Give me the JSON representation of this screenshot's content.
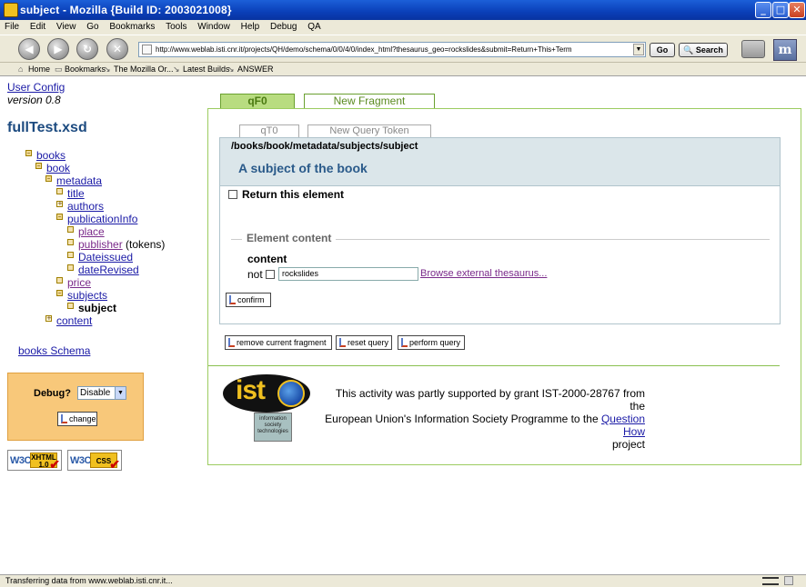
{
  "window": {
    "title": "subject - Mozilla {Build ID: 2003021008}"
  },
  "menu": [
    "File",
    "Edit",
    "View",
    "Go",
    "Bookmarks",
    "Tools",
    "Window",
    "Help",
    "Debug",
    "QA"
  ],
  "navigation": {
    "url": "http://www.weblab.isti.cnr.it/projects/QH/demo/schema/0/0/4/0/index_html?thesaurus_geo=rockslides&submit=Return+This+Term",
    "go_label": "Go",
    "search_label": "Search"
  },
  "personal_toolbar": {
    "items": [
      "Home",
      "Bookmarks",
      "The Mozilla Or...",
      "Latest Builds",
      "ANSWER"
    ]
  },
  "sidebar": {
    "user_config": "User Config",
    "version": "version 0.8",
    "schema_file": "fullTest.xsd",
    "tree": {
      "books": "books",
      "book": "book",
      "metadata": "metadata",
      "title": "title",
      "authors": "authors",
      "publicationInfo": "publicationInfo",
      "place": "place",
      "publisher": "publisher",
      "publisher_suffix": "(tokens)",
      "dateissued": "Dateissued",
      "dateRevised": "dateRevised",
      "price": "price",
      "subjects": "subjects",
      "subject": "subject",
      "content": "content"
    },
    "schema_link": "books Schema",
    "debug": {
      "label": "Debug?",
      "selected": "Disable",
      "change_label": "change"
    },
    "badges": {
      "xhtml_top": "XHTML",
      "xhtml_bottom": "1.0",
      "css": "CSS",
      "w3c": "W3C"
    }
  },
  "fragment": {
    "active_tab": "qF0",
    "new_tab": "New Fragment",
    "query_tabs": {
      "current": "qT0",
      "new": "New Query Token"
    },
    "xpath": "/books/book/metadata/subjects/subject",
    "description": "A subject of the book",
    "return_label": "Return this element",
    "element_content_legend": "Element content",
    "content_label": "content",
    "not_label": "not",
    "term_value": "rockslides",
    "browse_link": "Browse external thesaurus...",
    "confirm_label": "confirm"
  },
  "actions": {
    "remove": "remove current fragment",
    "reset": "reset query",
    "perform": "perform query"
  },
  "footer": {
    "ist_logo_text": "ist",
    "ist_box_text": "information society technologies",
    "support_line1": "This activity was partly supported by grant IST-2000-28767 from the",
    "support_line2_prefix": "European Union's Information Society Programme to the",
    "support_link": "Question How",
    "support_line3": "project"
  },
  "status": {
    "text": "Transferring data from www.weblab.isti.cnr.it..."
  }
}
